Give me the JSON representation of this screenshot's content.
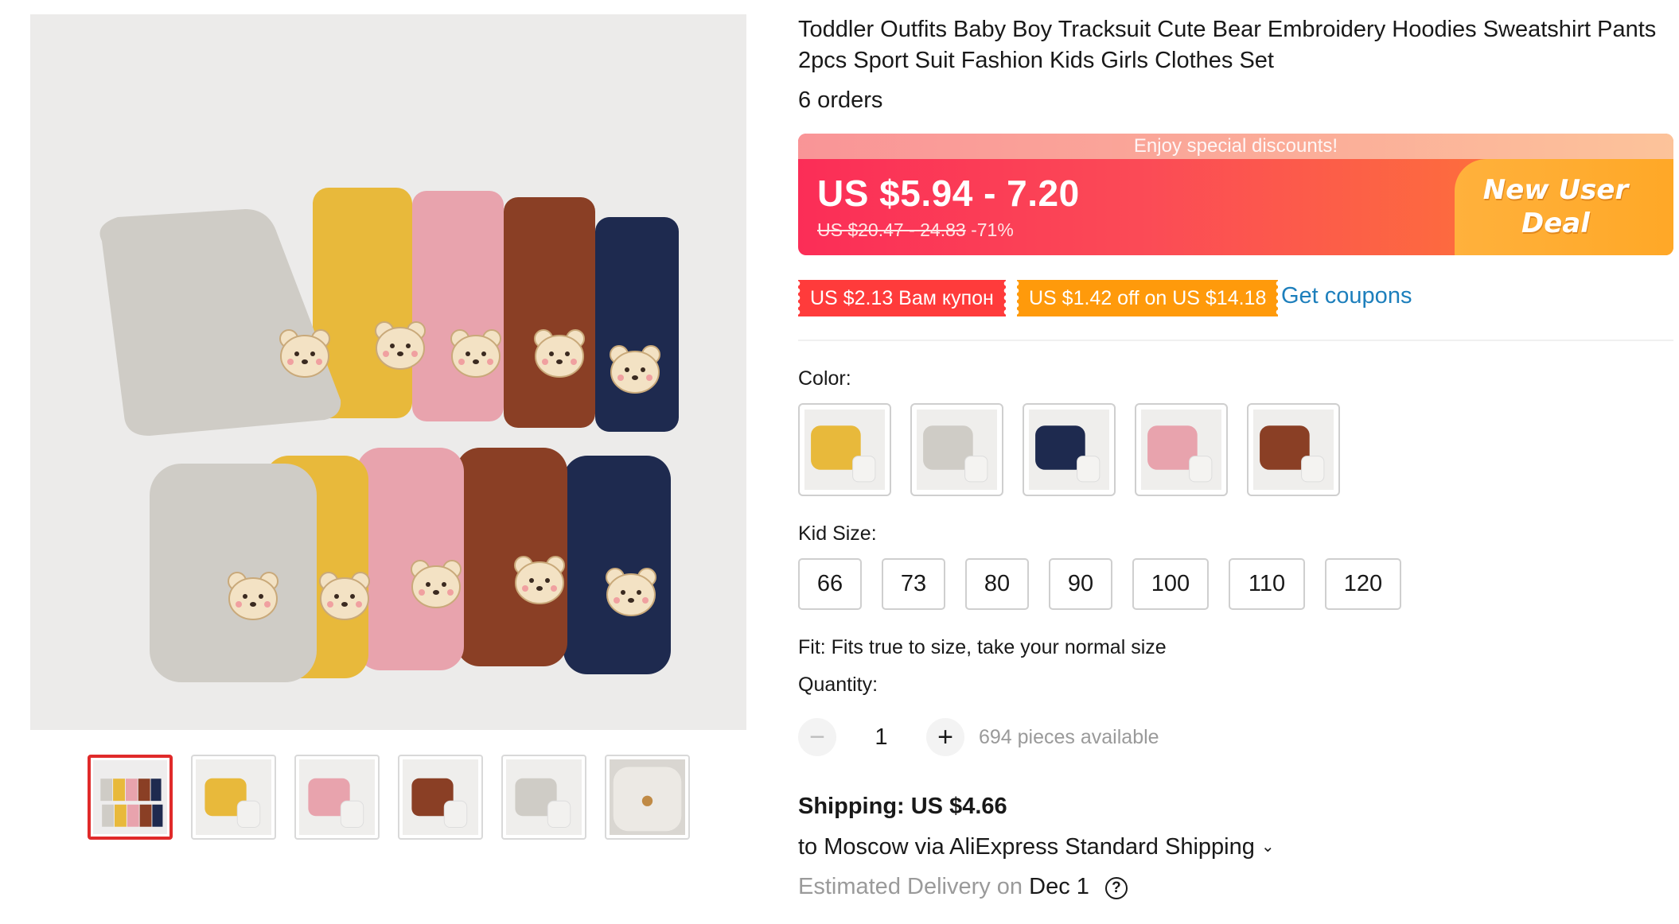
{
  "product": {
    "title": "Toddler Outfits Baby Boy Tracksuit Cute Bear Embroidery Hoodies Sweatshirt Pants 2pcs Sport Suit Fashion Kids Girls Clothes Set",
    "orders": "6 orders"
  },
  "price": {
    "banner": "Enjoy special discounts!",
    "current": "US $5.94 - 7.20",
    "original": "US $20.47 - 24.83",
    "discount": "-71%",
    "deal_badge": "New User Deal"
  },
  "coupons": {
    "coupon_1": "US $2.13 Вам купон",
    "coupon_2": "US $1.42 off on US $14.18",
    "get_coupons": "Get coupons"
  },
  "color": {
    "label": "Color:",
    "options": [
      {
        "name": "yellow",
        "hex": "#e8b93b"
      },
      {
        "name": "gray",
        "hex": "#cfccc6"
      },
      {
        "name": "navy",
        "hex": "#1e2a4f"
      },
      {
        "name": "pink",
        "hex": "#e8a3ad"
      },
      {
        "name": "brown",
        "hex": "#8a3f25"
      }
    ]
  },
  "size": {
    "label": "Kid Size:",
    "options": [
      "66",
      "73",
      "80",
      "90",
      "100",
      "110",
      "120"
    ],
    "fit_note": "Fit: Fits true to size, take your normal size"
  },
  "quantity": {
    "label": "Quantity:",
    "minus": "−",
    "value": "1",
    "plus": "+",
    "available": "694 pieces available"
  },
  "shipping": {
    "title": "Shipping: US $4.66",
    "destination": "to Moscow via AliExpress Standard Shipping",
    "chevron": "⌄",
    "eta_label": "Estimated Delivery on",
    "eta_date": "Dec 1",
    "help": "?"
  },
  "colors": {
    "accent_red": "#e02a2a",
    "link_blue": "#1d7fbc",
    "price_gradient_start": "#fb2d57",
    "deal_orange": "#ffa827",
    "coupon_red": "#ff3b3b",
    "coupon_orange": "#ff9a0b"
  }
}
